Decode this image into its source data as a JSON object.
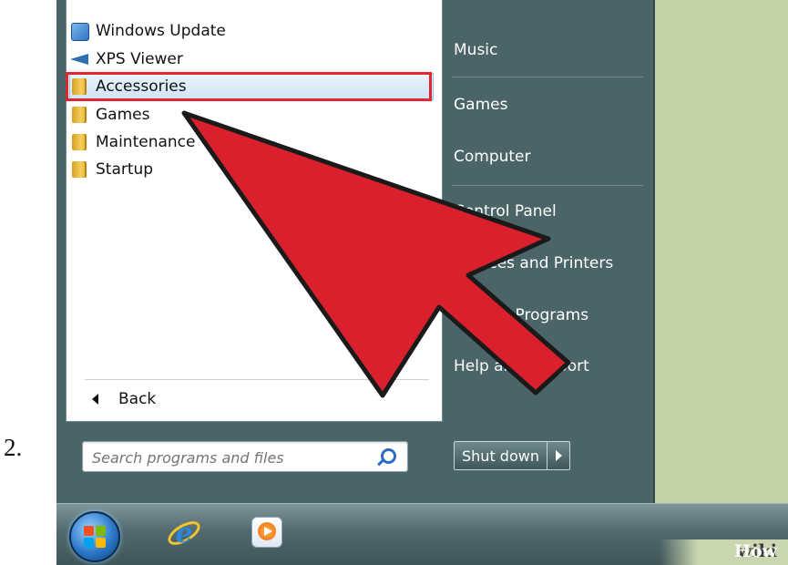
{
  "step": {
    "number": "2."
  },
  "start_menu": {
    "programs": [
      {
        "label": "Windows Update",
        "icon": "windows-update-icon"
      },
      {
        "label": "XPS Viewer",
        "icon": "xps-viewer-icon"
      },
      {
        "label": "Accessories",
        "icon": "folder-icon",
        "selected": true
      },
      {
        "label": "Games",
        "icon": "folder-icon"
      },
      {
        "label": "Maintenance",
        "icon": "folder-icon"
      },
      {
        "label": "Startup",
        "icon": "folder-icon"
      }
    ],
    "back_label": "Back",
    "search": {
      "placeholder": "Search programs and files"
    },
    "right_links": [
      "Music",
      "Games",
      "Computer",
      "Control Panel",
      "Devices and Printers",
      "Default Programs",
      "Help and Support"
    ],
    "shutdown_label": "Shut down"
  },
  "taskbar": {
    "items": [
      "start-orb",
      "internet-explorer-icon",
      "media-player-icon"
    ]
  },
  "annotation": {
    "highlight_color": "#e0262f",
    "arrow_color": "#d9202c"
  },
  "watermark": {
    "wiki": "wiki",
    "how": "How"
  }
}
